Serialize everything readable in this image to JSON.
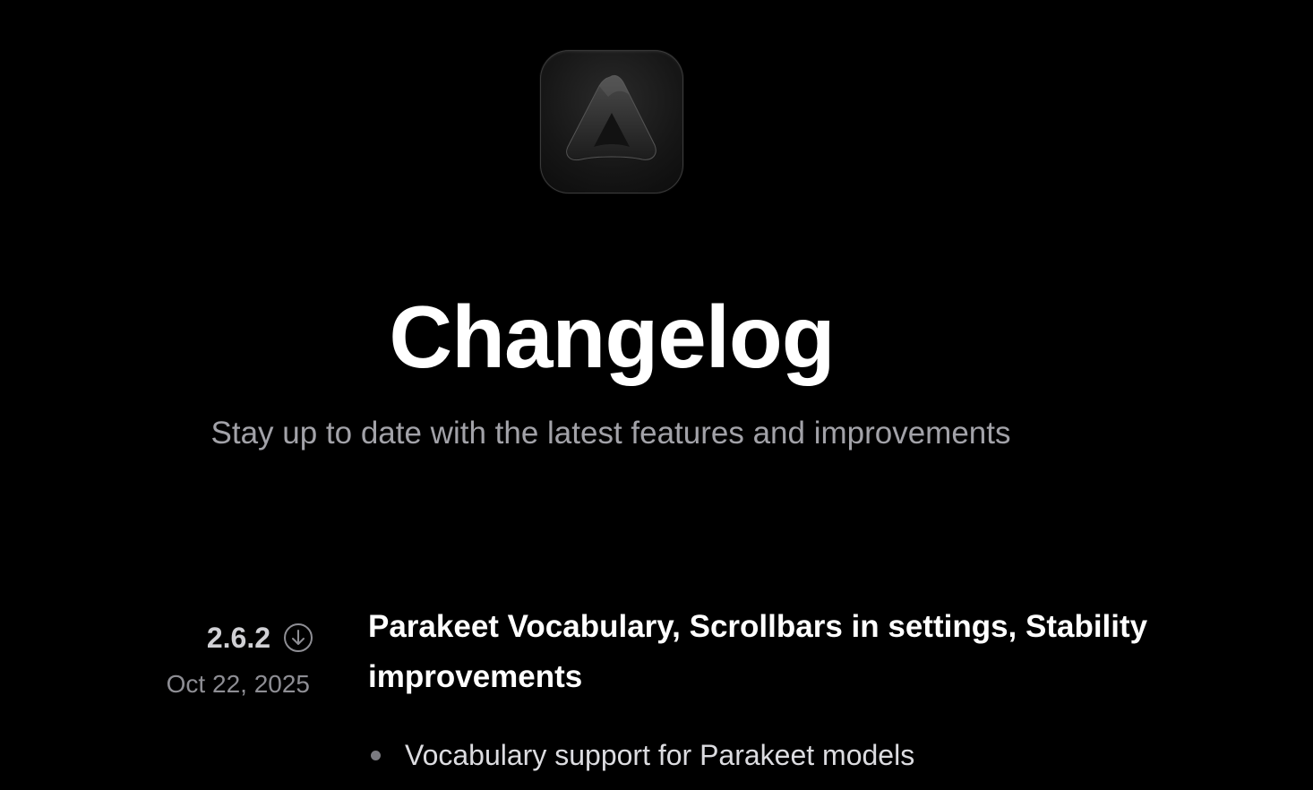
{
  "logo": {
    "icon": "app-logo-triangle-icon"
  },
  "header": {
    "title": "Changelog",
    "subtitle": "Stay up to date with the latest features and improvements"
  },
  "releases": [
    {
      "version": "2.6.2",
      "date": "Oct 22, 2025",
      "download_icon": "download-icon",
      "title": "Parakeet Vocabulary, Scrollbars in settings, Stability improvements",
      "notes": [
        "Vocabulary support for Parakeet models"
      ]
    }
  ],
  "colors": {
    "background": "#000000",
    "title": "#ffffff",
    "subtitle": "#a2a2a8",
    "muted": "#8e8e94"
  }
}
